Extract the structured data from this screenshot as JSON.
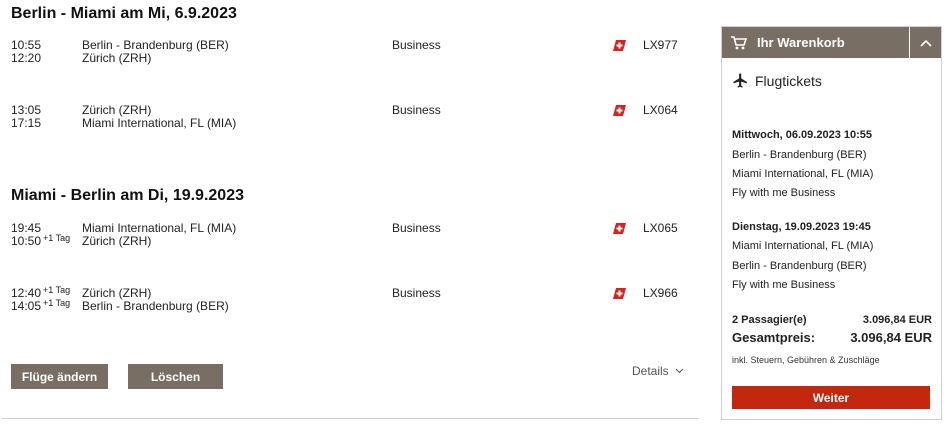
{
  "itinerary": {
    "outbound": {
      "title": "Berlin - Miami am Mi, 6.9.2023",
      "segments": [
        {
          "dep_time": "10:55",
          "arr_time": "12:20",
          "arr_day_offset": "",
          "dep_day_offset": "",
          "from": "Berlin - Brandenburg (BER)",
          "to": "Zürich (ZRH)",
          "cabin": "Business",
          "flight": "LX977"
        },
        {
          "dep_time": "13:05",
          "arr_time": "17:15",
          "arr_day_offset": "",
          "dep_day_offset": "",
          "from": "Zürich (ZRH)",
          "to": "Miami International, FL (MIA)",
          "cabin": "Business",
          "flight": "LX064"
        }
      ]
    },
    "return": {
      "title": "Miami - Berlin am Di, 19.9.2023",
      "segments": [
        {
          "dep_time": "19:45",
          "arr_time": "10:50",
          "dep_day_offset": "",
          "arr_day_offset": "+1 Tag",
          "from": "Miami International, FL (MIA)",
          "to": "Zürich (ZRH)",
          "cabin": "Business",
          "flight": "LX065"
        },
        {
          "dep_time": "12:40",
          "arr_time": "14:05",
          "dep_day_offset": "+1 Tag",
          "arr_day_offset": "+1 Tag",
          "from": "Zürich (ZRH)",
          "to": "Berlin - Brandenburg (BER)",
          "cabin": "Business",
          "flight": "LX966"
        }
      ]
    },
    "buttons": {
      "change": "Flüge ändern",
      "delete": "Löschen",
      "details": "Details"
    }
  },
  "cart": {
    "title": "Ihr Warenkorb",
    "section": "Flugtickets",
    "outbound": {
      "date": "Mittwoch, 06.09.2023 10:55",
      "from": "Berlin - Brandenburg (BER)",
      "to": "Miami International, FL (MIA)",
      "fare": "Fly with me Business"
    },
    "return": {
      "date": "Dienstag, 19.09.2023 19:45",
      "from": "Miami International, FL (MIA)",
      "to": "Berlin - Brandenburg (BER)",
      "fare": "Fly with me Business"
    },
    "passengers_label": "2 Passagier(e)",
    "passengers_price": "3.096,84 EUR",
    "total_label": "Gesamtpreis:",
    "total_price": "3.096,84 EUR",
    "tax_note": "inkl. Steuern, Gebühren & Zuschläge",
    "continue": "Weiter"
  },
  "colors": {
    "brand_brown": "#786e64",
    "accent_red": "#c4260e",
    "airline_logo": "#d5231f"
  },
  "icons": {
    "cart": "shopping-cart-icon",
    "toggle": "chevron-up-icon",
    "plane": "airplane-icon",
    "details": "chevron-down-icon",
    "airline": "swiss-airline-logo"
  }
}
